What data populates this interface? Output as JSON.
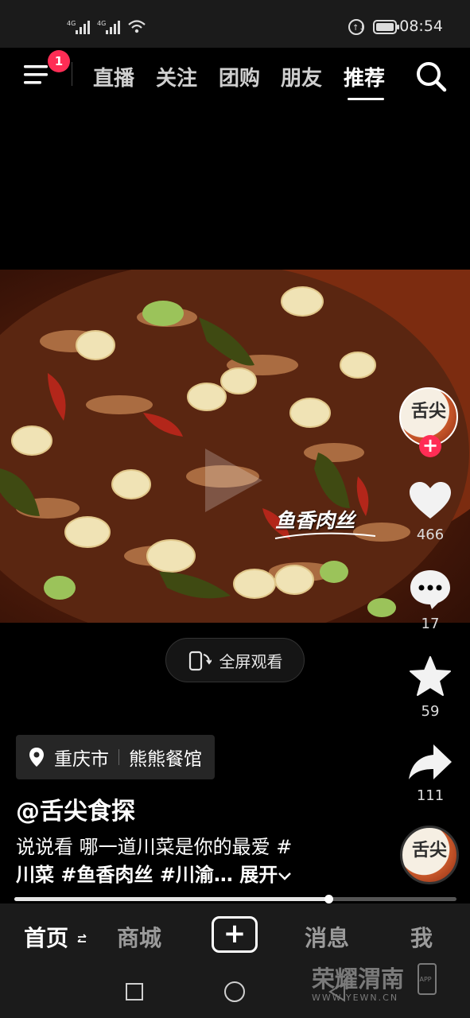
{
  "status_bar": {
    "signal1": "4G",
    "signal2": "4G",
    "time": "08:54"
  },
  "top_nav": {
    "badge": "1",
    "tabs": [
      "直播",
      "关注",
      "团购",
      "朋友",
      "推荐"
    ],
    "active_tab": "推荐"
  },
  "video": {
    "overlay_title": "鱼香肉丝"
  },
  "fullscreen": {
    "label": "全屏观看"
  },
  "rail": {
    "avatar_text": "舌尖",
    "likes": "466",
    "comments": "17",
    "favorites": "59",
    "shares": "111",
    "music_avatar_text": "舌尖"
  },
  "location": {
    "city": "重庆市",
    "place": "熊熊餐馆"
  },
  "post": {
    "author": "@舌尖食探",
    "caption_line1": "说说看 哪一道川菜是你的最爱 #",
    "caption_line2": "川菜 #鱼香肉丝 #川渝…",
    "expand": "展开",
    "progress": 0.71
  },
  "bottom_nav": {
    "home": "首页",
    "mall": "商城",
    "messages": "消息",
    "me": "我"
  },
  "watermark": {
    "brand": "荣耀渭南",
    "url": "WWW.YEWN.CN",
    "app": "APP"
  },
  "colors": {
    "accent": "#ff2d55"
  }
}
